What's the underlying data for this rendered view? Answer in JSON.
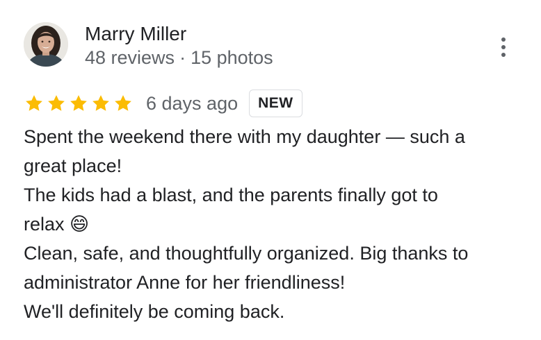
{
  "reviewer": {
    "name": "Marry Miller",
    "reviews_count": "48 reviews",
    "separator": "·",
    "photos_count": "15 photos"
  },
  "rating": {
    "stars": 5,
    "max_stars": 5,
    "star_color": "#fbbc04",
    "time_ago": "6 days ago",
    "badge": "NEW"
  },
  "review_lines": [
    "Spent the weekend there with my daughter — such a",
    "great place!",
    "The kids had a blast, and the parents finally got to",
    "relax 😄",
    "Clean, safe, and thoughtfully organized. Big thanks to",
    "administrator Anne for her friendliness!",
    "We'll definitely be coming back."
  ],
  "icons": {
    "menu": "more-vert-icon",
    "star": "star-icon"
  },
  "colors": {
    "primary_text": "#202124",
    "secondary_text": "#5f6368",
    "badge_border": "#dadce0"
  }
}
